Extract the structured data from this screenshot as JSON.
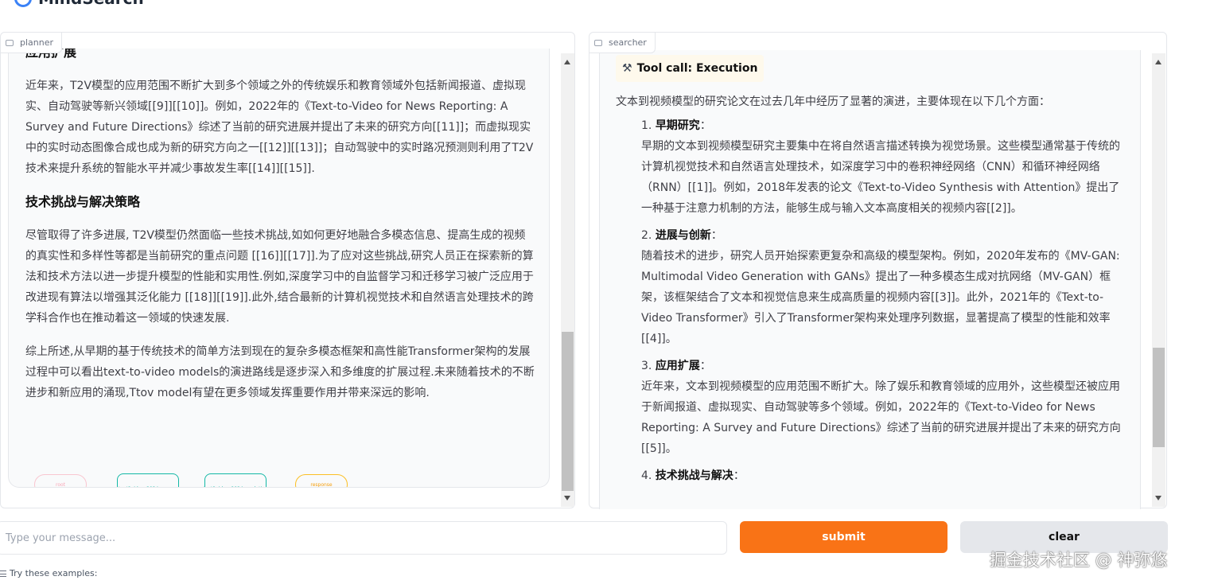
{
  "app": {
    "title": "MindSearch"
  },
  "planner": {
    "label": "planner",
    "h_expand": "应用扩展",
    "p_expand": "近年来，T2V模型的应用范围不断扩大到多个领域之外的传统娱乐和教育领域外包括新闻报道、虚拟现实、自动驾驶等新兴领域[[9]][[10]]。例如，2022年的《Text-to-Video for News Reporting: A Survey and Future Directions》综述了当前的研究进展并提出了未来的研究方向[[11]]；而虚拟现实中的实时动态图像合成也成为新的研究方向之一[[12]][[13]]；自动驾驶中的实时路况预测则利用了T2V技术来提升系统的智能水平并减少事故发生率[[14]][[15]].",
    "h_challenge": "技术挑战与解决策略",
    "p_challenge": "尽管取得了许多进展, T2V模型仍然面临一些技术挑战,如如何更好地融合多模态信息、提高生成的视频的真实性和多样性等都是当前研究的重点问题 [[16]][[17]].为了应对这些挑战,研究人员正在探索新的算法和技术方法以进一步提升模型的性能和实用性.例如,深度学习中的自监督学习和迁移学习被广泛应用于改进现有算法以增强其泛化能力 [[18]][[19]].此外,结合最新的计算机视觉技术和自然语言处理技术的跨学科合作也在推动着这一领域的快速发展.",
    "p_summary": "综上所述,从早期的基于传统技术的简单方法到现在的复杂多模态框架和高性能Transformer架构的发展过程中可以看出text-to-video models的演进路线是逐步深入和多维度的扩展过程.未来随着技术的不断进步和新应用的涌现,Ttov model有望在更多领域发挥重要作用并带来深远的影响.",
    "graph": {
      "start": "root",
      "node_a": "text2video_2024_papers",
      "node_b": "text2video_2024_evolution",
      "end": "response"
    }
  },
  "searcher": {
    "label": "searcher",
    "tool_call": "Tool call: Execution",
    "intro": "文本到视频模型的研究论文在过去几年中经历了显著的演进，主要体现在以下几个方面：",
    "items": [
      {
        "num": "1. ",
        "title": "早期研究",
        "colon": "：",
        "body": "早期的文本到视频模型研究主要集中在将自然语言描述转换为视觉场景。这些模型通常基于传统的计算机视觉技术和自然语言处理技术，如深度学习中的卷积神经网络（CNN）和循环神经网络（RNN）[[1]]。例如，2018年发表的论文《Text-to-Video Synthesis with Attention》提出了一种基于注意力机制的方法，能够生成与输入文本高度相关的视频内容[[2]]。"
      },
      {
        "num": "2. ",
        "title": "进展与创新",
        "colon": "：",
        "body": "随着技术的进步，研究人员开始探索更复杂和高级的模型架构。例如，2020年发布的《MV-GAN: Multimodal Video Generation with GANs》提出了一种多模态生成对抗网络（MV-GAN）框架，该框架结合了文本和视觉信息来生成高质量的视频内容[[3]]。此外，2021年的《Text-to-Video Transformer》引入了Transformer架构来处理序列数据，显著提高了模型的性能和效率[[4]]。"
      },
      {
        "num": "3. ",
        "title": "应用扩展",
        "colon": "：",
        "body": "近年来，文本到视频模型的应用范围不断扩大。除了娱乐和教育领域的应用外，这些模型还被应用于新闻报道、虚拟现实、自动驾驶等多个领域。例如，2022年的《Text-to-Video for News Reporting: A Survey and Future Directions》综述了当前的研究进展并提出了未来的研究方向[[5]]。"
      },
      {
        "num": "4. ",
        "title": "技术挑战与解决",
        "colon": "：",
        "body": ""
      }
    ]
  },
  "input": {
    "placeholder": "Type your message..."
  },
  "buttons": {
    "submit": "submit",
    "clear": "clear"
  },
  "examples_label": "Try these examples:",
  "watermark": "掘金技术社区 @ 神弥悠",
  "colors": {
    "accent": "#f97316",
    "teal": "#14b8a6",
    "amber": "#fbbf24"
  }
}
